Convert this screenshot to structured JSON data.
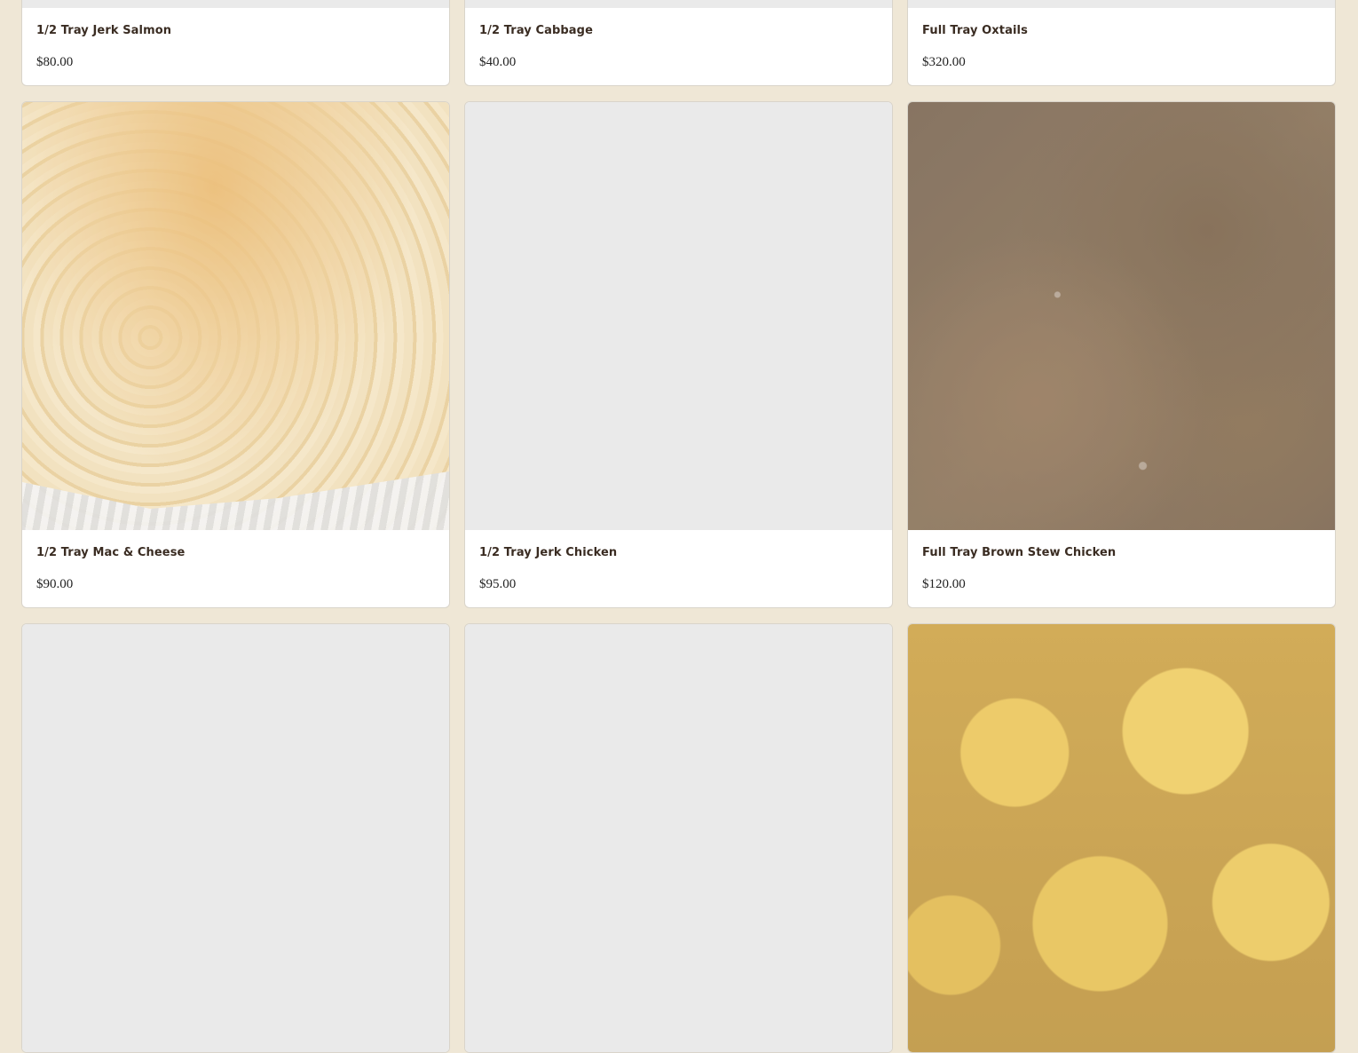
{
  "items": [
    {
      "name": "1/2 Tray Jerk Salmon",
      "price": "$80.00"
    },
    {
      "name": "1/2 Tray Cabbage",
      "price": "$40.00"
    },
    {
      "name": "Full Tray Oxtails",
      "price": "$320.00"
    },
    {
      "name": "1/2 Tray Mac & Cheese",
      "price": "$90.00",
      "image": "mac-and-cheese-photo"
    },
    {
      "name": "1/2 Tray Jerk Chicken",
      "price": "$95.00"
    },
    {
      "name": "Full Tray Brown Stew Chicken",
      "price": "$120.00",
      "image": "brown-stew-chicken-photo"
    },
    {
      "image": "placeholder"
    },
    {
      "image": "placeholder"
    },
    {
      "image": "curry-shrimp-photo"
    }
  ],
  "colors": {
    "page_background": "#efe7d6",
    "card_background": "#ffffff",
    "image_placeholder": "#eaeaea",
    "item_name": "#3a2c22"
  }
}
